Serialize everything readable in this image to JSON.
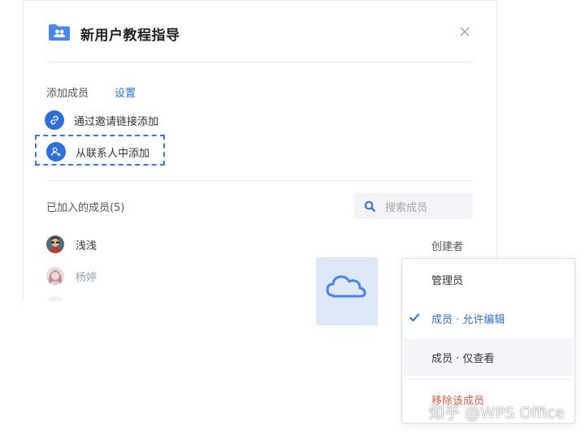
{
  "dialog": {
    "title": "新用户教程指导",
    "close_icon": "close-icon",
    "folder_icon": "team-folder-icon",
    "tabs": [
      {
        "label": "添加成员",
        "active": false
      },
      {
        "label": "设置",
        "active": true
      }
    ],
    "add_options": [
      {
        "label": "通过邀请链接添加",
        "icon": "link-icon"
      },
      {
        "label": "从联系人中添加",
        "icon": "add-contact-icon",
        "highlighted": true
      }
    ],
    "members_section": {
      "title": "已加入的成员(5)",
      "search_placeholder": "搜索成员"
    },
    "members": [
      {
        "name": "浅浅",
        "role": "创建者"
      },
      {
        "name": "杨婷",
        "role": ""
      }
    ]
  },
  "role_menu": {
    "items": [
      {
        "label": "管理员",
        "selected": false
      },
      {
        "label": "成员 · 允许编辑",
        "selected": true
      },
      {
        "label": "成员 · 仅查看",
        "selected": false,
        "hovered": true
      },
      {
        "label": "移除该成员",
        "danger": true
      }
    ]
  },
  "colors": {
    "accent": "#2f6fd8",
    "danger": "#e25a45",
    "muted_text": "#9aa0a8"
  },
  "watermark": "知乎 @WPS Office"
}
